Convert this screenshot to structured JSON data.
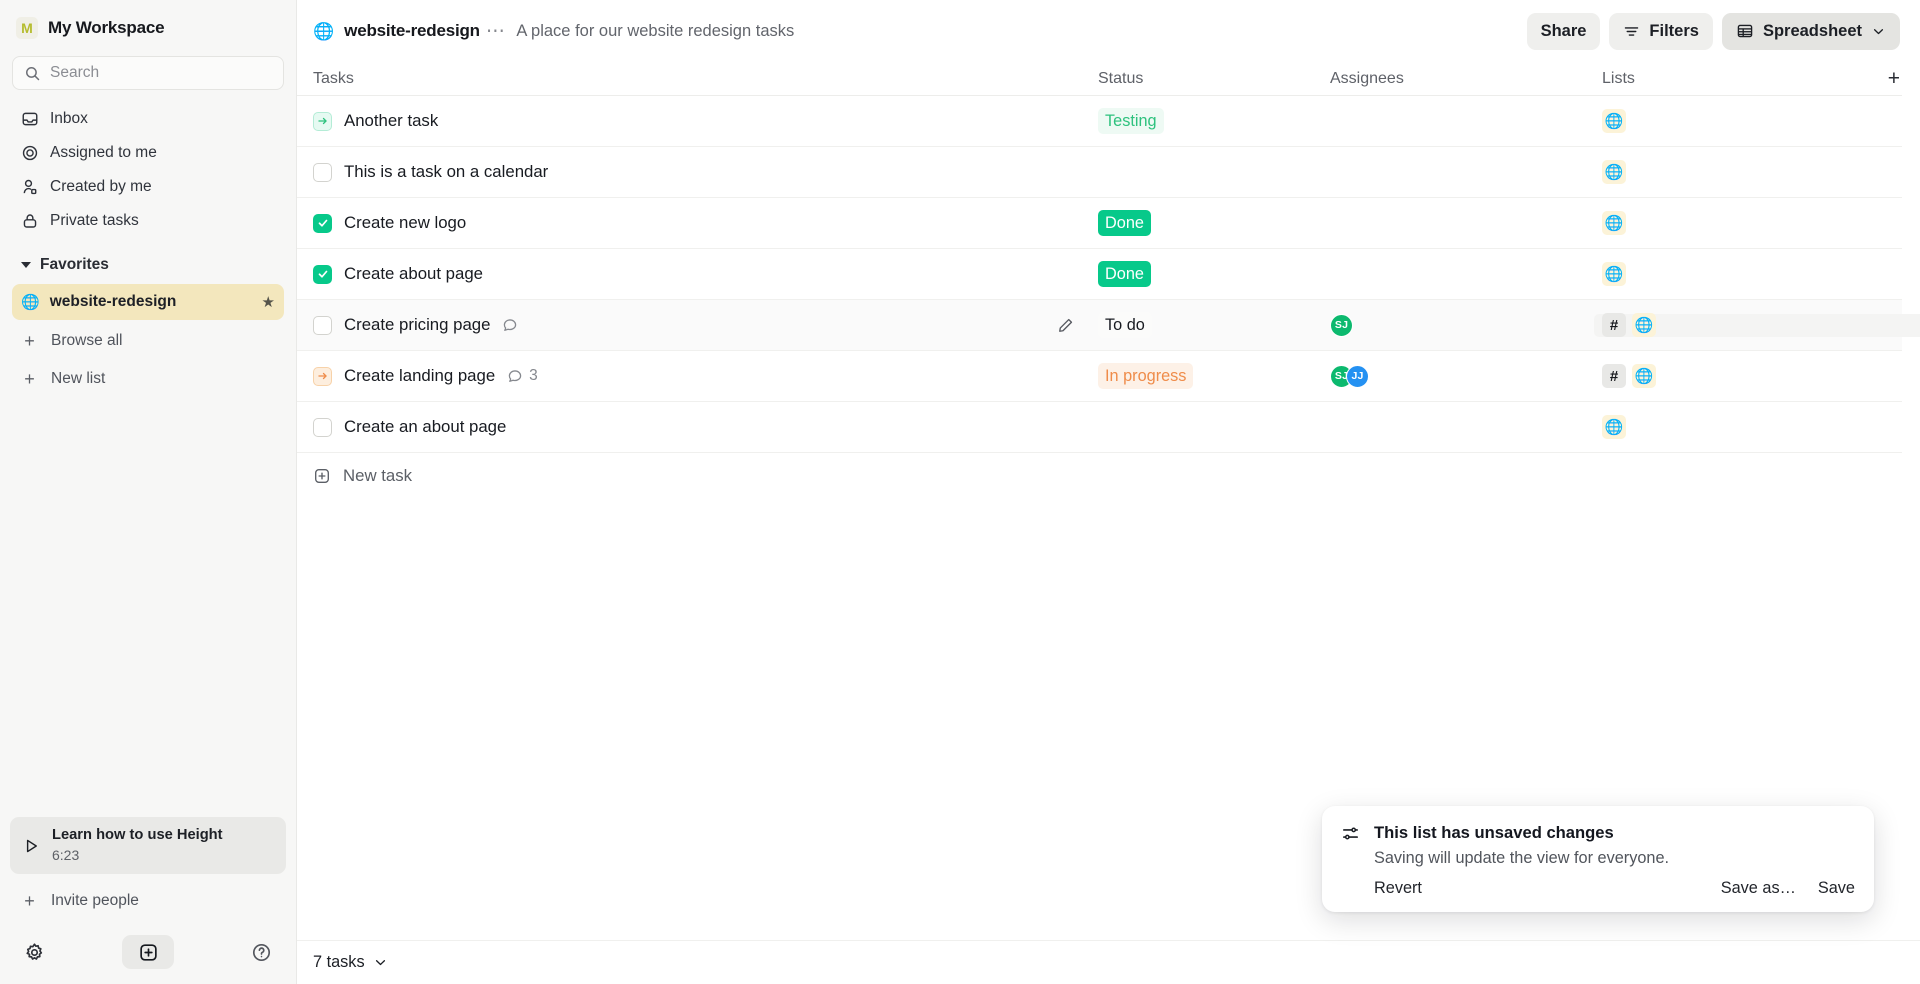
{
  "sidebar": {
    "workspace": {
      "avatar_letter": "M",
      "name": "My Workspace"
    },
    "search": {
      "placeholder": "Search"
    },
    "nav_items": [
      {
        "label": "Inbox",
        "icon": "inbox-icon"
      },
      {
        "label": "Assigned to me",
        "icon": "target-icon"
      },
      {
        "label": "Created by me",
        "icon": "person-add-icon"
      },
      {
        "label": "Private tasks",
        "icon": "lock-icon"
      }
    ],
    "favorites": {
      "label": "Favorites",
      "items": [
        {
          "label": "website-redesign",
          "icon": "globe-icon",
          "starred": true
        }
      ]
    },
    "browse_all": "Browse all",
    "new_list": "New list",
    "learn_card": {
      "title": "Learn how to use Height",
      "duration": "6:23"
    },
    "invite_people": "Invite people",
    "footer": {
      "settings": "gear-icon",
      "new": "plus-square-icon",
      "help": "question-circle-icon"
    }
  },
  "header": {
    "list_icon": "globe-icon",
    "list_name": "website-redesign",
    "overflow": "⋯",
    "description": "A place for our website redesign tasks",
    "share_label": "Share",
    "filters_label": "Filters",
    "view_label": "Spreadsheet"
  },
  "table": {
    "columns": [
      "Tasks",
      "Status",
      "Assignees",
      "Lists"
    ],
    "add_column": "+",
    "rows": [
      {
        "name": "Another task",
        "marker": "arrow-green",
        "comments": null,
        "status": {
          "label": "Testing",
          "style": "testing"
        },
        "assignees": [],
        "lists": [
          {
            "type": "globe"
          }
        ]
      },
      {
        "name": "This is a task on a calendar",
        "marker": "checkbox",
        "comments": null,
        "status": {
          "label": "",
          "style": "none"
        },
        "assignees": [],
        "lists": [
          {
            "type": "globe"
          }
        ]
      },
      {
        "name": "Create new logo",
        "marker": "checkbox-done",
        "comments": null,
        "status": {
          "label": "Done",
          "style": "done"
        },
        "assignees": [],
        "lists": [
          {
            "type": "globe"
          }
        ]
      },
      {
        "name": "Create about page",
        "marker": "checkbox-done",
        "comments": null,
        "status": {
          "label": "Done",
          "style": "done"
        },
        "assignees": [],
        "lists": [
          {
            "type": "globe"
          }
        ]
      },
      {
        "name": "Create pricing page",
        "marker": "checkbox",
        "comments": {
          "icon": "comment-icon",
          "count": ""
        },
        "status": {
          "label": "To do",
          "style": "todo"
        },
        "assignees": [
          {
            "initials": "SJ",
            "color": "#0cb96e"
          }
        ],
        "lists": [
          {
            "type": "hash"
          },
          {
            "type": "globe"
          }
        ],
        "hovered": true,
        "edit_icon": "pencil-icon"
      },
      {
        "name": "Create landing page",
        "marker": "arrow-orange",
        "comments": {
          "icon": "comment-icon",
          "count": "3"
        },
        "status": {
          "label": "In progress",
          "style": "inprogress"
        },
        "assignees": [
          {
            "initials": "SJ",
            "color": "#0cb96e"
          },
          {
            "initials": "JJ",
            "color": "#2491f2"
          }
        ],
        "lists": [
          {
            "type": "hash"
          },
          {
            "type": "globe"
          }
        ]
      },
      {
        "name": "Create an about page",
        "marker": "checkbox",
        "comments": null,
        "status": {
          "label": "",
          "style": "none"
        },
        "assignees": [],
        "lists": [
          {
            "type": "globe"
          }
        ]
      }
    ],
    "new_task_label": "New task",
    "footer_count": "7 tasks"
  },
  "toast": {
    "icon": "sliders-icon",
    "title": "This list has unsaved changes",
    "subtitle": "Saving will update the view for everyone.",
    "revert_label": "Revert",
    "save_as_label": "Save as…",
    "save_label": "Save"
  },
  "colors": {
    "accent_green": "#07c98a",
    "status_testing": "#2ec27e",
    "status_inprogress": "#ef8c4a",
    "favorite_bg": "#f3e7bd",
    "sidebar_bg": "#f7f7f6"
  }
}
